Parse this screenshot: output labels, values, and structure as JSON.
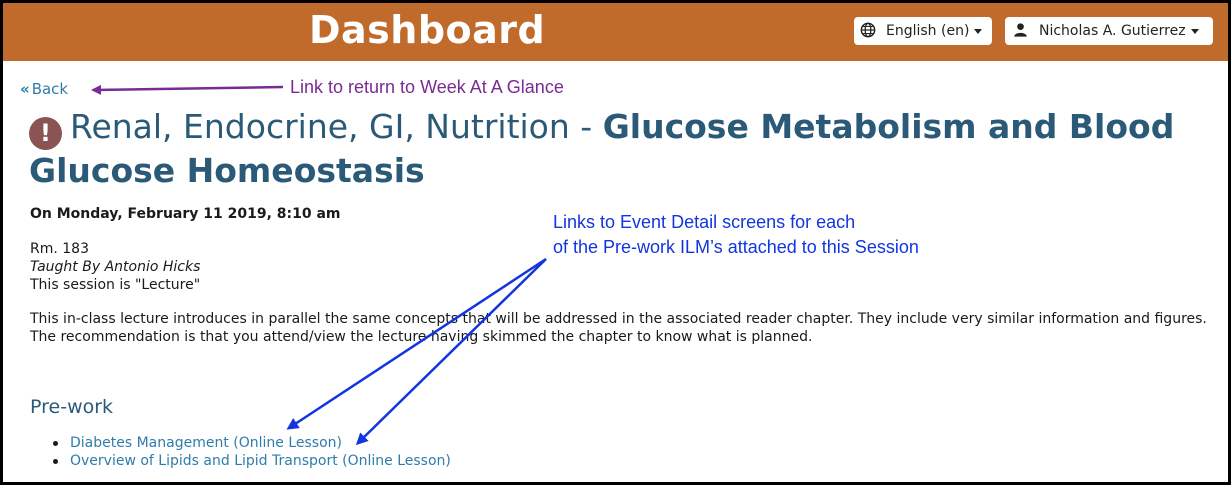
{
  "header": {
    "title": "Dashboard",
    "language": "English (en)",
    "user": "Nicholas A. Gutierrez"
  },
  "back": {
    "label": "Back"
  },
  "annotations": {
    "back": "Link to return to Week At A Glance",
    "prework_line1": "Links to Event Detail screens for each",
    "prework_line2": "of the Pre-work ILM’s attached to this Session"
  },
  "session": {
    "course": "Renal, Endocrine, GI, Nutrition - ",
    "title": "Glucose Metabolism and Blood Glucose Homeostasis",
    "when": "On Monday, February 11 2019, 8:10 am",
    "room": "Rm. 183",
    "taught_by": "Taught By Antonio Hicks",
    "session_type": "This session is \"Lecture\"",
    "description_line1": "This in-class lecture introduces in parallel the same concepts that will be addressed in the associated reader chapter. They include very similar information and figures.",
    "description_line2": "The recommendation is that you attend/view the lecture having skimmed the chapter to know what is planned."
  },
  "prework": {
    "heading": "Pre-work",
    "items": [
      {
        "label": "Diabetes Management (Online Lesson)"
      },
      {
        "label": "Overview of Lipids and Lipid Transport (Online Lesson)"
      }
    ]
  },
  "colors": {
    "header_bg": "#c06a2b",
    "link": "#2f7cab",
    "title": "#2b5a78",
    "annotation_purple": "#7a2a92",
    "annotation_blue": "#1235e0",
    "alert_icon": "#8b5452"
  },
  "icons": {
    "language": "globe-icon",
    "user": "user-icon",
    "back": "double-chevron-left-icon",
    "title": "exclamation-circle-icon"
  }
}
